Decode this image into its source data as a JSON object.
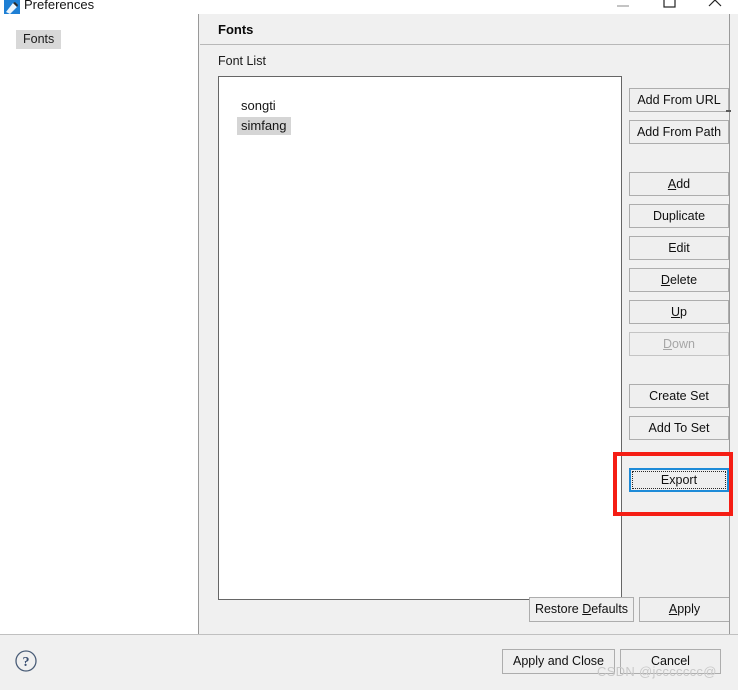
{
  "window": {
    "title": "Preferences",
    "icon": "app-icon",
    "controls": {
      "minimize": "minimize-icon",
      "maximize": "maximize-icon",
      "close": "close-icon"
    }
  },
  "sidebar": {
    "items": [
      {
        "label": "Fonts",
        "selected": true
      }
    ]
  },
  "content": {
    "title": "Fonts",
    "group_label": "Font List",
    "font_list": [
      {
        "label": "songti",
        "selected": false
      },
      {
        "label": "simfang",
        "selected": true
      }
    ],
    "buttons": [
      {
        "label": "Add From URL",
        "mnemonic": "",
        "enabled": true
      },
      {
        "label": "Add From Path",
        "mnemonic": "",
        "enabled": true
      },
      {
        "label": "Add",
        "mnemonic": "A",
        "enabled": true
      },
      {
        "label": "Duplicate",
        "mnemonic": "",
        "enabled": true
      },
      {
        "label": "Edit",
        "mnemonic": "",
        "enabled": true
      },
      {
        "label": "Delete",
        "mnemonic": "D",
        "enabled": true
      },
      {
        "label": "Up",
        "mnemonic": "U",
        "enabled": true
      },
      {
        "label": "Down",
        "mnemonic": "D",
        "enabled": false
      },
      {
        "label": "Create Set",
        "mnemonic": "",
        "enabled": true
      },
      {
        "label": "Add To Set",
        "mnemonic": "",
        "enabled": true
      }
    ],
    "export_button": {
      "label": "Export",
      "focused": true,
      "highlight_color": "#f51d14"
    },
    "restore_defaults": {
      "label": "Restore Defaults",
      "mnemonic": "D"
    },
    "apply": {
      "label": "Apply",
      "mnemonic": "A"
    }
  },
  "footer": {
    "help_icon": "help-icon",
    "apply_and_close": "Apply and Close",
    "cancel": "Cancel"
  },
  "watermark": "CSDN @jccccccc@"
}
